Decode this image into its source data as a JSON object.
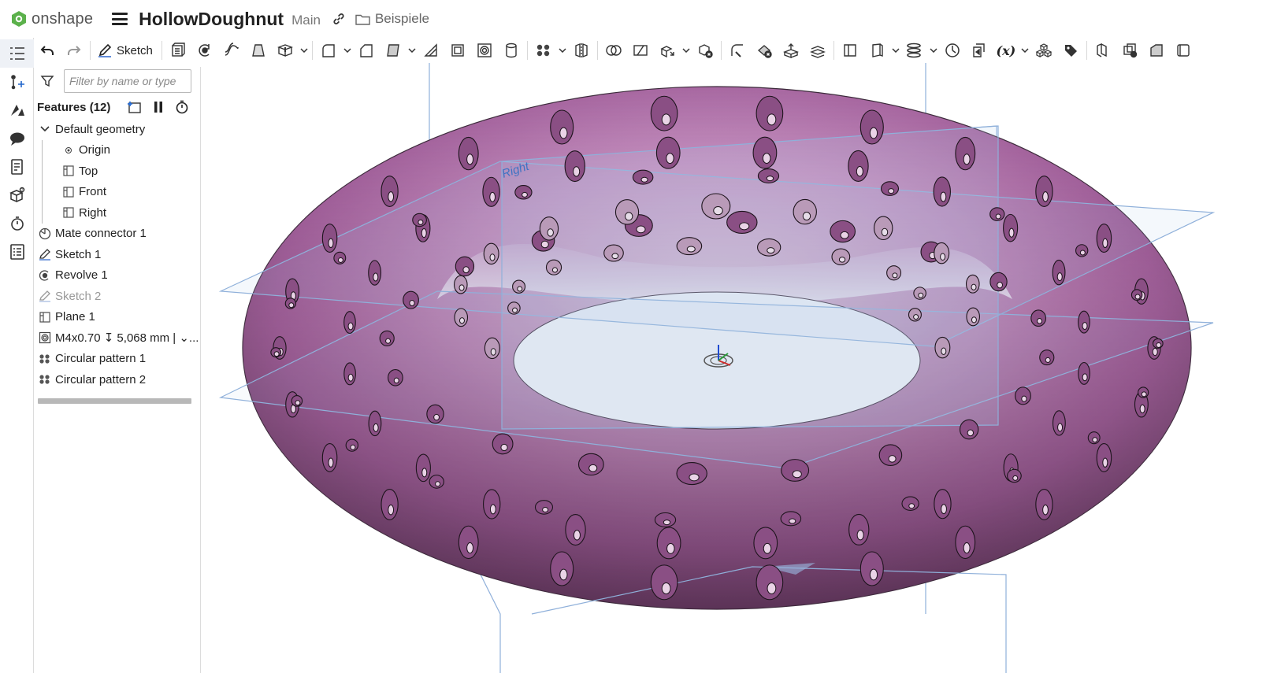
{
  "app": {
    "logo_text": "onshape",
    "document_title": "HollowDoughnut",
    "branch": "Main",
    "folder": "Beispiele"
  },
  "toolbar": {
    "sketch_label": "Sketch",
    "variable_label": "(x)"
  },
  "filter": {
    "placeholder": "Filter by name or type",
    "value": ""
  },
  "features": {
    "header": "Features (12)",
    "items": [
      {
        "label": "Default geometry",
        "icon": "chevron-down-icon",
        "level": 0
      },
      {
        "label": "Origin",
        "icon": "origin-icon",
        "level": 1
      },
      {
        "label": "Top",
        "icon": "plane-icon",
        "level": 1
      },
      {
        "label": "Front",
        "icon": "plane-icon",
        "level": 1
      },
      {
        "label": "Right",
        "icon": "plane-icon",
        "level": 1
      },
      {
        "label": "Mate connector 1",
        "icon": "mate-connector-icon",
        "level": 0
      },
      {
        "label": "Sketch 1",
        "icon": "sketch-icon",
        "level": 0
      },
      {
        "label": "Revolve 1",
        "icon": "revolve-icon",
        "level": 0
      },
      {
        "label": "Sketch 2",
        "icon": "sketch-icon",
        "level": 0,
        "dimmed": true
      },
      {
        "label": "Plane 1",
        "icon": "plane-icon",
        "level": 0
      },
      {
        "label": "M4x0.70 ↧ 5,068 mm | ⌄...",
        "icon": "hole-icon",
        "level": 0
      },
      {
        "label": "Circular pattern 1",
        "icon": "circular-pattern-icon",
        "level": 0
      },
      {
        "label": "Circular pattern 2",
        "icon": "circular-pattern-icon",
        "level": 0
      }
    ]
  },
  "viewport": {
    "plane_label": "Right",
    "body_color": "#b070a8",
    "plane_color": "#7fa6d6"
  }
}
